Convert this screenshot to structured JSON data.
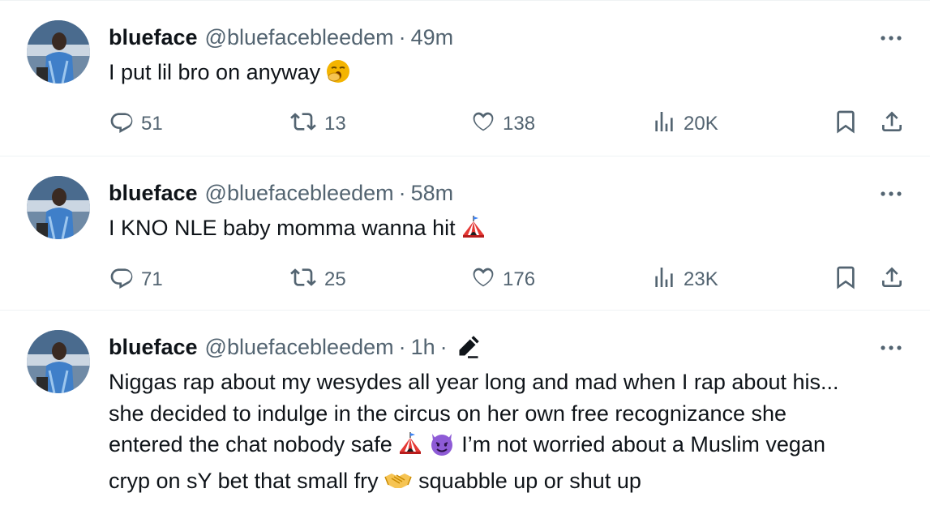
{
  "tweets": [
    {
      "name": "blueface",
      "handle": "@bluefacebleedem",
      "separator": "·",
      "time": "49m",
      "text": "I put lil bro on anyway",
      "emoji": "yawning-face",
      "stats": {
        "replies": "51",
        "retweets": "13",
        "likes": "138",
        "views": "20K"
      }
    },
    {
      "name": "blueface",
      "handle": "@bluefacebleedem",
      "separator": "·",
      "time": "58m",
      "text": "I KNO NLE baby momma wanna hit",
      "emoji": "circus-tent",
      "stats": {
        "replies": "71",
        "retweets": "25",
        "likes": "176",
        "views": "23K"
      }
    },
    {
      "name": "blueface",
      "handle": "@bluefacebleedem",
      "separator": "·",
      "time": "1h",
      "edited_separator": "·",
      "text_line1": "Niggas rap about my wesydes all year long and mad when I rap about his...",
      "text_line2": "she decided to indulge in the circus on her own free recognizance she",
      "text_line3a": "entered the chat nobody safe",
      "text_line3b": "I’m not worried about a Muslim vegan",
      "text_line4a": "cryp on sY bet that small fry",
      "text_line4b": "squabble up or shut up",
      "emojis": [
        "circus-tent",
        "smiling-face-with-horns",
        "handshake"
      ]
    }
  ],
  "colors": {
    "text": "#0f1419",
    "secondary": "#536471",
    "divider": "#eff3f4"
  }
}
